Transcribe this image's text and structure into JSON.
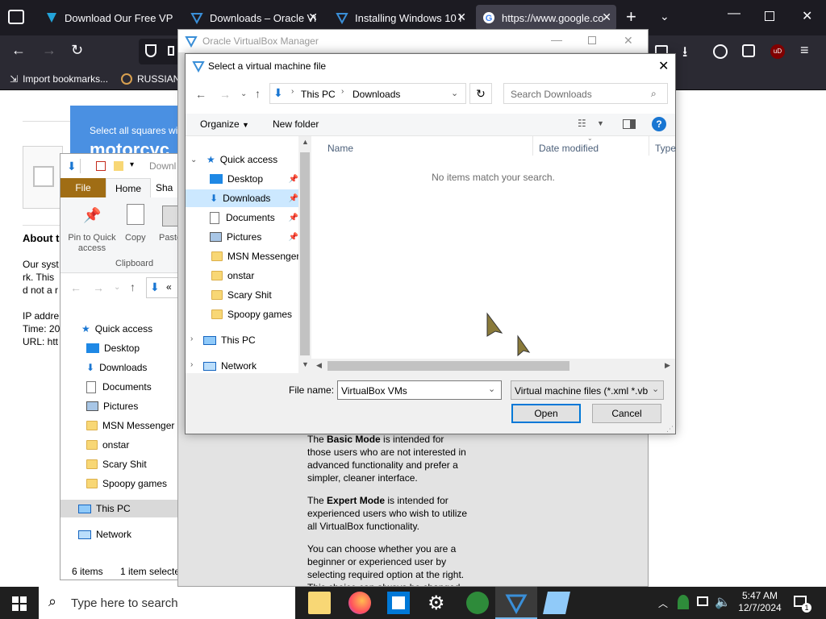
{
  "browser": {
    "tabs": [
      {
        "label": "Download Our Free VP"
      },
      {
        "label": "Downloads – Oracle Vi"
      },
      {
        "label": "Installing Windows 10 i"
      },
      {
        "label": "https://www.google.co"
      }
    ],
    "bookmarks": {
      "import": "Import bookmarks...",
      "russian": "RUSSIAN"
    }
  },
  "webpage": {
    "captcha_text": "Select all squares wi",
    "captcha_word": "motorcyc",
    "about_heading": "About t",
    "lines": [
      "Our syst",
      "rk. This",
      "d not a r",
      "",
      "IP addre",
      "Time: 20",
      "URL: htt"
    ]
  },
  "explorer": {
    "ribbon_tabs": {
      "file": "File",
      "home": "Home",
      "share": "Sha"
    },
    "title_fragment": "Downl",
    "ribbon": {
      "pin": "Pin to Quick access",
      "copy": "Copy",
      "paste": "Paste",
      "group": "Clipboard"
    },
    "nav": {
      "quick_access": "Quick access",
      "desktop": "Desktop",
      "downloads": "Downloads",
      "documents": "Documents",
      "pictures": "Pictures",
      "msn": "MSN Messenger",
      "onstar": "onstar",
      "scary": "Scary Shit",
      "spoopy": "Spoopy games",
      "thispc": "This PC",
      "network": "Network"
    },
    "status": {
      "items": "6 items",
      "selected": "1 item selecte"
    }
  },
  "vbox": {
    "title": "Oracle VirtualBox Manager",
    "text": {
      "basic": [
        "The ",
        "Basic Mode",
        " is intended for those users who are not interested in advanced functionality and prefer a simpler, cleaner interface."
      ],
      "expert": [
        "The ",
        "Expert Mode",
        " is intended for experienced users who wish to utilize all VirtualBox functionality."
      ],
      "choose": "You can choose whether you are a beginner or experienced user by selecting required option at the right. This choice can always be changed"
    }
  },
  "dialog": {
    "title": "Select a virtual machine file",
    "breadcrumb": {
      "thispc": "This PC",
      "downloads": "Downloads"
    },
    "search_placeholder": "Search Downloads",
    "toolbar": {
      "organize": "Organize",
      "new_folder": "New folder"
    },
    "columns": {
      "name": "Name",
      "date": "Date modified",
      "type": "Type"
    },
    "empty_message": "No items match your search.",
    "nav": {
      "quick_access": "Quick access",
      "desktop": "Desktop",
      "downloads": "Downloads",
      "documents": "Documents",
      "pictures": "Pictures",
      "msn": "MSN Messenger",
      "onstar": "onstar",
      "scary": "Scary Shit",
      "spoopy": "Spoopy games",
      "thispc": "This PC",
      "network": "Network"
    },
    "file_name_label": "File name:",
    "file_name_value": "VirtualBox VMs",
    "file_type": "Virtual machine files (*.xml *.vb",
    "open": "Open",
    "cancel": "Cancel"
  },
  "taskbar": {
    "search_placeholder": "Type here to search",
    "time": "5:47 AM",
    "date": "12/7/2024",
    "notification_count": "1"
  },
  "colors": {
    "browser_bg": "#1c1b22",
    "accent_blue": "#0078d7",
    "selected": "#cce8ff",
    "explorer_file_tab": "#a06d14"
  }
}
